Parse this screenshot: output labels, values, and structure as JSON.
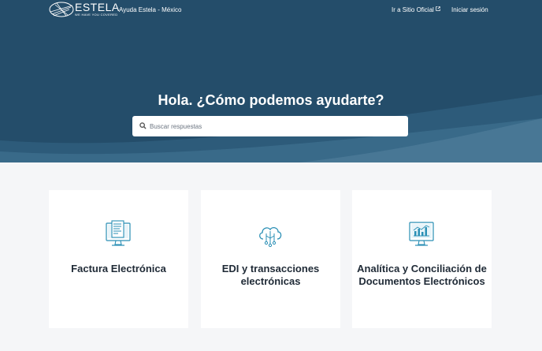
{
  "header": {
    "logo_text": "ESTELA",
    "logo_tagline": "WE HAVE YOU COVERED",
    "site_name": "Ayuda Estela - México",
    "official_site_link": "Ir a Sitio Oficial",
    "signin_link": "Iniciar sesión"
  },
  "hero": {
    "title": "Hola. ¿Cómo podemos ayudarte?",
    "search_placeholder": "Buscar respuestas"
  },
  "categories": [
    {
      "label": "Factura Electrónica",
      "icon": "invoice-computer-icon"
    },
    {
      "label": "EDI y transacciones electrónicas",
      "icon": "cloud-network-icon"
    },
    {
      "label": "Analítica y Conciliación de Documentos Electrónicos",
      "icon": "analytics-monitor-icon"
    }
  ],
  "colors": {
    "hero_background": "#244d6a",
    "icon_accent": "#2a8fb5",
    "page_background": "#f5f6f8"
  }
}
